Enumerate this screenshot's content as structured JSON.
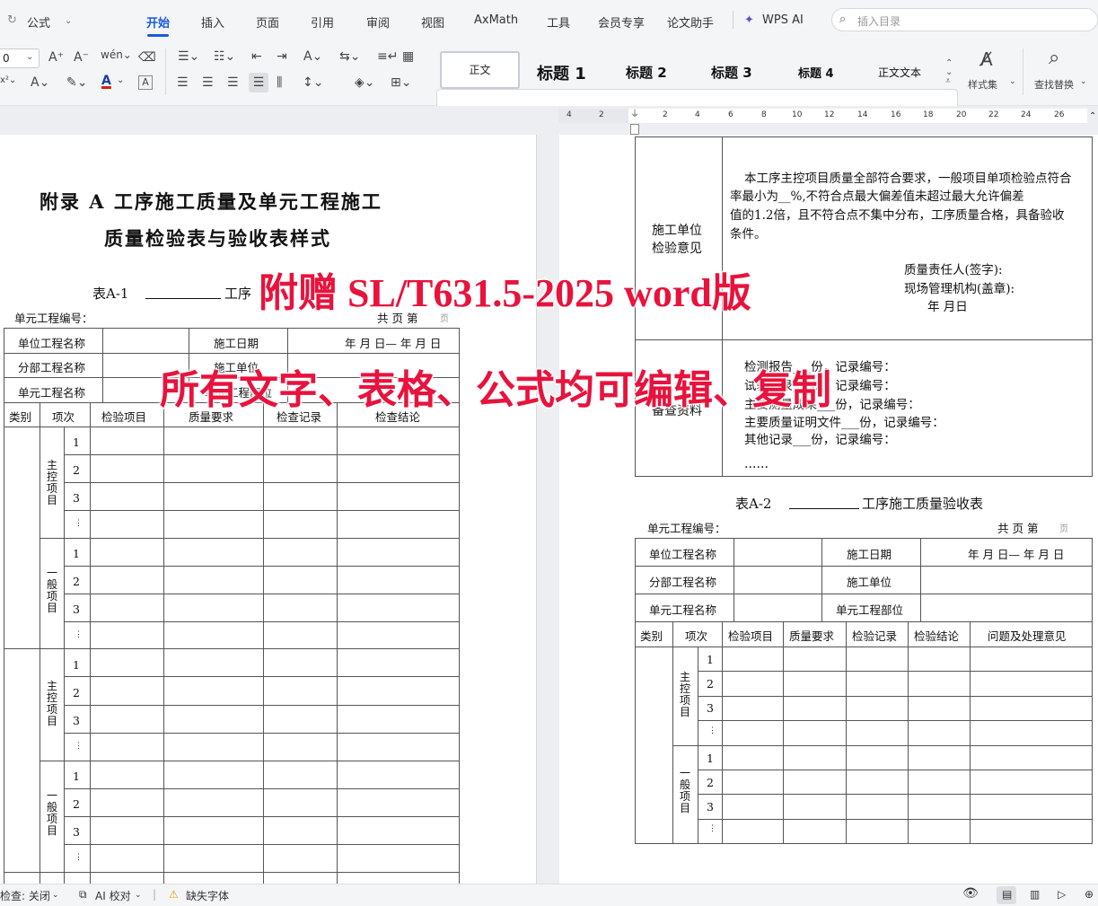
{
  "menu": {
    "formula_btn": "公式",
    "tabs": [
      "开始",
      "插入",
      "页面",
      "引用",
      "审阅",
      "视图",
      "AxMath",
      "工具",
      "会员专享",
      "论文助手",
      "WPS AI"
    ],
    "search_placeholder": "插入目录"
  },
  "ribbon": {
    "font_size": "0",
    "styles": [
      "正文",
      "标题 1",
      "标题 2",
      "标题 3",
      "标题 4",
      "正文文本"
    ],
    "style_set": "样式集",
    "find_replace": "查找替换"
  },
  "ruler": [
    "4",
    "2",
    "2",
    "4",
    "6",
    "8",
    "10",
    "12",
    "14",
    "16",
    "18",
    "20",
    "22",
    "24",
    "26"
  ],
  "left": {
    "title1": "附录 A   工序施工质量及单元工程施工",
    "title2": "质量检验表与验收表样式",
    "table_label": "表A-1",
    "table_title_tail": "工序",
    "unit_no": "单元工程编号：",
    "pages": "共  页  第",
    "page_suffix": "页",
    "rows": [
      {
        "c1": "单位工程名称",
        "c2": "施工日期",
        "c3": "年  月  日—  年  月   日"
      },
      {
        "c1": "分部工程名称",
        "c2": "施工单位"
      },
      {
        "c1": "单元工程名称",
        "c2": "单元工程部位"
      }
    ],
    "headers": [
      "类别",
      "项次",
      "检验项目",
      "质量要求",
      "检查记录",
      "检查结论"
    ],
    "cats": [
      "主控项目",
      "一般项目",
      "主控项目",
      "一般项目"
    ],
    "nums": [
      "1",
      "2",
      "3",
      "⋮"
    ]
  },
  "right": {
    "top_label": "施工单位\n检验意见",
    "top_p1": "本工序主控项目质量全部符合要求，一般项目单项检验点符合",
    "top_p2": "率最小为__%,不符合点最大偏差值未超过最大允许偏差",
    "top_p3": "值的1.2倍，且不符合点不集中分布，工序质量合格，具备验收",
    "top_p4": "条件。",
    "sign1": "质量责任人(签字):",
    "sign2": "现场管理机构(盖章):",
    "sign3": "年  月日",
    "beicha_label": "备查资料",
    "beicha": [
      "检测报告___份，记录编号：",
      "试验记录___份，记录编号：",
      "主要测量成果___份，记录编号：",
      "主要质量证明文件___份，记录编号：",
      "其他记录___份，记录编号：",
      "……"
    ],
    "table2_label": "表A-2",
    "table2_title": "工序施工质量验收表",
    "unit_no": "单元工程编号：",
    "pages": "共  页  第",
    "page_suffix": "页",
    "rows": [
      {
        "c1": "单位工程名称",
        "c2": "施工日期",
        "c3": "年  月  日—  年  月   日"
      },
      {
        "c1": "分部工程名称",
        "c2": "施工单位"
      },
      {
        "c1": "单元工程名称",
        "c2": "单元工程部位"
      }
    ],
    "headers": [
      "类别",
      "项次",
      "检验项目",
      "质量要求",
      "检验记录",
      "检验结论",
      "问题及处理意见"
    ],
    "cats": [
      "主控项目",
      "一般项目"
    ],
    "nums": [
      "1",
      "2",
      "3",
      "⋮"
    ]
  },
  "overlay": {
    "line1": "附赠 SL/T631.5-2025 word版",
    "line2": "所有文字、表格、公式均可编辑、复制"
  },
  "status": {
    "check": "检查: 关闭",
    "ai": "AI 校对",
    "missing_font": "缺失字体"
  }
}
